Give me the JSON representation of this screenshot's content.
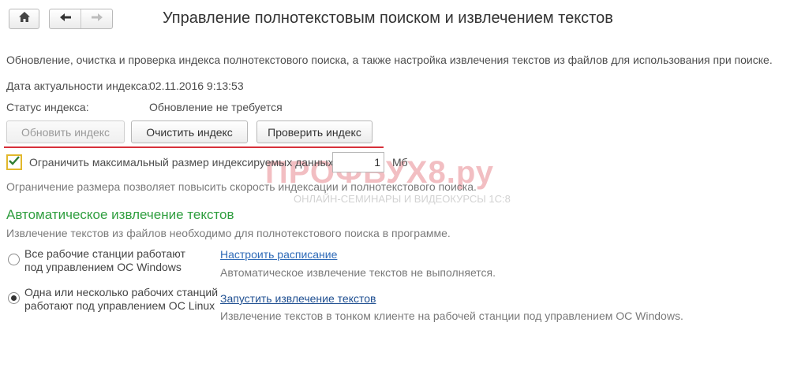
{
  "nav": {
    "home_icon": "home-icon",
    "back_icon": "arrow-left-icon",
    "forward_icon": "arrow-right-icon"
  },
  "header": {
    "title": "Управление полнотекстовым поиском и извлечением текстов"
  },
  "description": "Обновление, очистка и проверка индекса полнотекстового поиска, а также настройка извлечения текстов из файлов для использования при поиске.",
  "index": {
    "date_label": "Дата актуальности индекса:",
    "date_value": "02.11.2016 9:13:53",
    "status_label": "Статус индекса:",
    "status_value": "Обновление не требуется"
  },
  "buttons": {
    "update": "Обновить индекс",
    "clear": "Очистить индекс",
    "check": "Проверить индекс"
  },
  "limit": {
    "checked": true,
    "label": "Ограничить максимальный размер индексируемых данных:",
    "value": "1",
    "unit": "Мб",
    "hint": "Ограничение размера позволяет повысить скорость индексации и полнотекстового поиска."
  },
  "extraction": {
    "section_title": "Автоматическое извлечение текстов",
    "hint": "Извлечение текстов из файлов необходимо для полнотекстового поиска в программе.",
    "options": [
      {
        "selected": false,
        "label_line1": "Все рабочие станции работают",
        "label_line2": "под управлением ОС Windows",
        "link": "Настроить расписание",
        "status": "Автоматическое извлечение текстов не выполняется."
      },
      {
        "selected": true,
        "label_line1": "Одна или несколько рабочих станций",
        "label_line2": "работают под управлением ОС Linux",
        "link": "Запустить извлечение текстов",
        "status": "Извлечение текстов в тонком клиенте на рабочей станции под управлением ОС Windows."
      }
    ]
  },
  "watermark": {
    "logo": "ПРОФБУХ8.ру",
    "subtitle": "ОНЛАЙН-СЕМИНАРЫ И ВИДЕОКУРСЫ 1С:8"
  },
  "colors": {
    "section_title": "#2f9e3f",
    "link": "#2e6ab7",
    "highlight_line": "#d6303a",
    "checkbox_border": "#e2b82c"
  }
}
